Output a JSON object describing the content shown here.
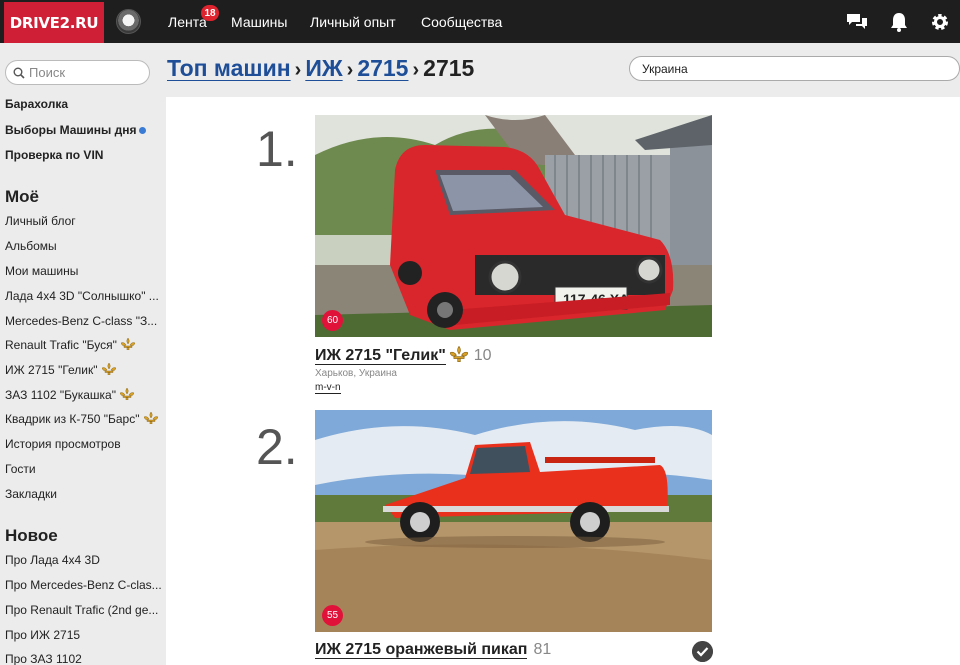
{
  "header": {
    "logo": "DRIVE2.RU",
    "nav": {
      "feed": "Лента",
      "feed_badge": "18",
      "cars": "Машины",
      "experience": "Личный опыт",
      "communities": "Сообщества"
    },
    "icons": [
      "chat-icon",
      "bell-icon",
      "gear-icon"
    ]
  },
  "sidebar": {
    "search_placeholder": "Поиск",
    "top_links": [
      "Барахолка",
      "Выборы Машины дня",
      "Проверка по VIN"
    ],
    "mine_title": "Моё",
    "mine_links": [
      "Личный блог",
      "Альбомы",
      "Мои машины",
      "Лада 4x4 3D \"Солнышко\" ...",
      "Mercedes-Benz C-class \"З...",
      "Renault Trafic \"Буся\"",
      "ИЖ 2715 \"Гелик\"",
      "ЗАЗ 1102 \"Букашка\"",
      "Квадрик из К-750 \"Барс\"",
      "История просмотров",
      "Гости",
      "Закладки"
    ],
    "new_title": "Новое",
    "new_links": [
      "Про Лада 4x4 3D",
      "Про Mercedes-Benz C-clas...",
      "Про Renault Trafic (2nd ge...",
      "Про ИЖ 2715",
      "Про ЗАЗ 1102"
    ]
  },
  "breadcrumb": {
    "root": "Топ машин",
    "brand": "ИЖ",
    "model": "2715",
    "current": "2715",
    "sep": "›"
  },
  "region": "Украина",
  "items": [
    {
      "rank": "1.",
      "badge": "60",
      "title": "ИЖ 2715 \"Гелик\"",
      "count": "10",
      "location": "Харьков, Украина",
      "user": "m-v-n"
    },
    {
      "rank": "2.",
      "badge": "55",
      "title": "ИЖ 2715 оранжевый пикап",
      "count": "81"
    }
  ],
  "colors": {
    "accent": "#cf1f36",
    "link": "#1e4e97",
    "badge": "#e0123a"
  }
}
